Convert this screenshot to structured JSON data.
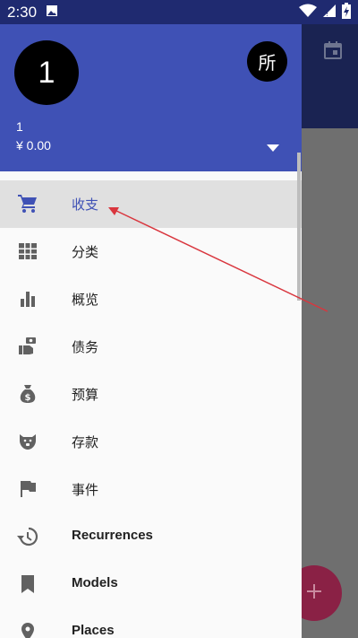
{
  "status_bar": {
    "time": "2:30"
  },
  "drawer": {
    "avatar_initial": "1",
    "avatar_secondary": "所",
    "account_name": "1",
    "account_balance": "¥ 0.00",
    "menu": [
      {
        "label": "收支",
        "icon": "shopping-cart-icon",
        "active": true
      },
      {
        "label": "分类",
        "icon": "grid-table-icon",
        "active": false
      },
      {
        "label": "概览",
        "icon": "bar-chart-icon",
        "active": false
      },
      {
        "label": "债务",
        "icon": "money-hand-icon",
        "active": false
      },
      {
        "label": "预算",
        "icon": "money-bag-icon",
        "active": false
      },
      {
        "label": "存款",
        "icon": "piggy-bank-icon",
        "active": false
      },
      {
        "label": "事件",
        "icon": "flag-icon",
        "active": false
      },
      {
        "label": "Recurrences",
        "icon": "history-icon",
        "active": false
      },
      {
        "label": "Models",
        "icon": "bookmark-icon",
        "active": false
      },
      {
        "label": "Places",
        "icon": "place-icon",
        "active": false
      }
    ]
  },
  "colors": {
    "header": "#3f51b5",
    "active_text": "#3f51b5",
    "fab": "#8a2145",
    "annotation_arrow": "#d9363e"
  }
}
